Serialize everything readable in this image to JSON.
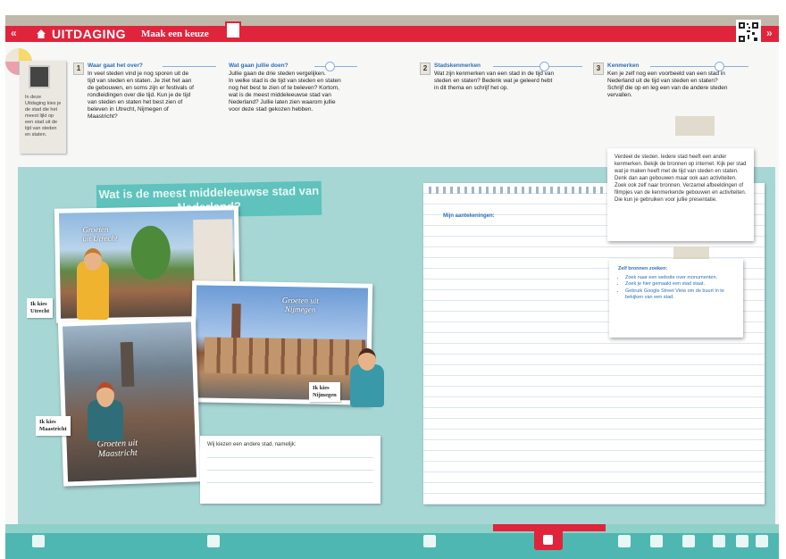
{
  "header": {
    "title": "UITDAGING",
    "subtitle": "Maak een keuze",
    "prev_arrow": "«",
    "next_arrow": "»",
    "qr_label": "..."
  },
  "tip": {
    "text": "In deze Uitdaging kies je de stad die het meest lijkt op een stad uit de tijd van steden en staten."
  },
  "steps": [
    {
      "num": "1",
      "heading": "Waar gaat het over?",
      "body": "In veel steden vind je nog sporen uit de\ntijd van steden en staten. Je ziet het aan\nde gebouwen, en soms zijn er festivals of\nrondleidingen over die tijd. Kun je de tijd\nvan steden en staten het best zien of\nbeleven in Utrecht, Nijmegen of\nMaastricht?"
    },
    {
      "num": "",
      "heading": "Wat gaan jullie doen?",
      "body": "Jullie gaan de drie steden vergelijken.\nIn welke stad is de tijd van steden en staten\nnog het best te zien of te beleven? Kortom,\nwat is de meest middeleeuwse stad van\nNederland? Jullie laten zien waarom jullie\nvoor deze stad gekozen hebben."
    },
    {
      "num": "2",
      "heading": "Stadskenmerken",
      "body": "Wat zijn kenmerken van een stad in de tijd van\nsteden en staten? Bedenk wat je geleerd hebt\nin dit thema en schrijf het op."
    },
    {
      "num": "3",
      "heading": "Kenmerken",
      "body": "Ken je zelf nog een voorbeeld van een stad in\nNederland uit de tijd van steden en staten?\nSchrijf die op en leg een van de andere steden\nvervallen."
    }
  ],
  "banner": "Wat is de meest middeleeuwse stad van Nederland?",
  "photos": {
    "utrecht": "Groeten\nuit Utrecht",
    "nijmegen": "Groeten uit\nNijmegen",
    "maastricht": "Groeten uit\nMaastricht"
  },
  "speech": {
    "utrecht": "Ik kies\nUtrecht",
    "nijmegen": "Ik kies\nNijmegen",
    "maastricht": "Ik kies\nMaastricht"
  },
  "answer_label": "Wij kiezen een andere stad, namelijk:",
  "notebook_label": "Mijn aantekeningen:",
  "instruction_note": "Verdeel de steden. Iedere stad heeft een ander kenmerken. Bekijk de bronnen op internet. Kijk per stad wat je maken heeft met de tijd van steden en staten. Denk dan aan gebouwen maar ook aan activiteiten. Zoek ook zelf naar bronnen. Verzamel afbeeldingen of filmpjes van de kenmerkende gebouwen en activiteiten. Die kun je gebruiken voor jullie presentatie.",
  "sources": {
    "title": "Zelf bronnen zoeken:",
    "items": [
      "Zoek naar een website over monumenten.",
      "Zoek je hier gemaakt een stad staat.",
      "Gebruik Google Street View om de buurt in te bekijken van een stad."
    ]
  },
  "colors": {
    "accent_red": "#e0243c",
    "teal_panel": "#a7d7d5",
    "teal_bar": "#4fb7b1",
    "banner_teal": "#5fc2bd",
    "link_blue": "#2f6fb6"
  }
}
